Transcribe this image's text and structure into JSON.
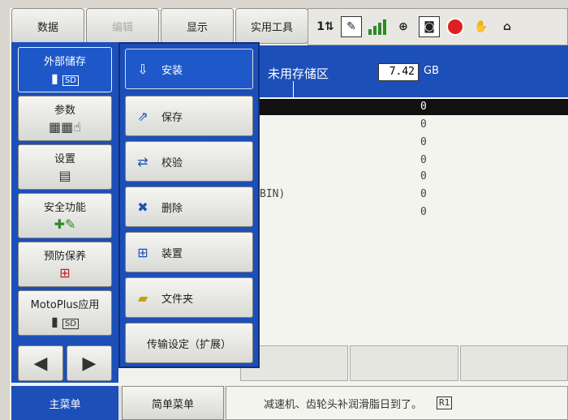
{
  "top_menu": {
    "data": "数据",
    "edit": "编辑",
    "display": "显示",
    "utility": "实用工具"
  },
  "status_icons": [
    "12-icon",
    "edit-mode-icon",
    "signal-bars-icon",
    "coordinate-icon",
    "camera-icon",
    "stop-icon",
    "hand-icon",
    "lock-icon"
  ],
  "content": {
    "header_label": "未用存储区",
    "header_value": "7.42",
    "header_unit": "GB",
    "rows": [
      {
        "text": "",
        "value": "0"
      },
      {
        "text": "",
        "value": "0"
      },
      {
        "text": "",
        "value": "0"
      },
      {
        "text": "",
        "value": "0"
      },
      {
        "text": "",
        "value": "0"
      },
      {
        "text": "BIN)",
        "value": "0"
      },
      {
        "text": "",
        "value": "0"
      }
    ]
  },
  "main_menu": {
    "items": [
      {
        "label": "外部储存",
        "icon": "sd-card-icon"
      },
      {
        "label": "参数",
        "icon": "parameter-icon"
      },
      {
        "label": "设置",
        "icon": "setup-icon"
      },
      {
        "label": "安全功能",
        "icon": "safety-icon"
      },
      {
        "label": "预防保养",
        "icon": "maintenance-icon"
      },
      {
        "label": "MotoPlus应用",
        "icon": "sd-card-icon"
      }
    ],
    "prev_glyph": "◀",
    "next_glyph": "▶"
  },
  "sub_menu": {
    "items": [
      {
        "label": "安装"
      },
      {
        "label": "保存"
      },
      {
        "label": "校验"
      },
      {
        "label": "删除"
      },
      {
        "label": "装置"
      },
      {
        "label": "文件夹"
      },
      {
        "label": "传输设定（扩展）"
      }
    ]
  },
  "bottom_bar": {
    "main_menu": "主菜单",
    "simple_menu": "简单菜单",
    "message": "减速机、齿轮头补润滑脂日到了。",
    "message_tag": "R1"
  },
  "colors": {
    "accent_blue": "#1c4fb8",
    "button_face": "#e6e6e2",
    "background": "#f2f1ec"
  }
}
